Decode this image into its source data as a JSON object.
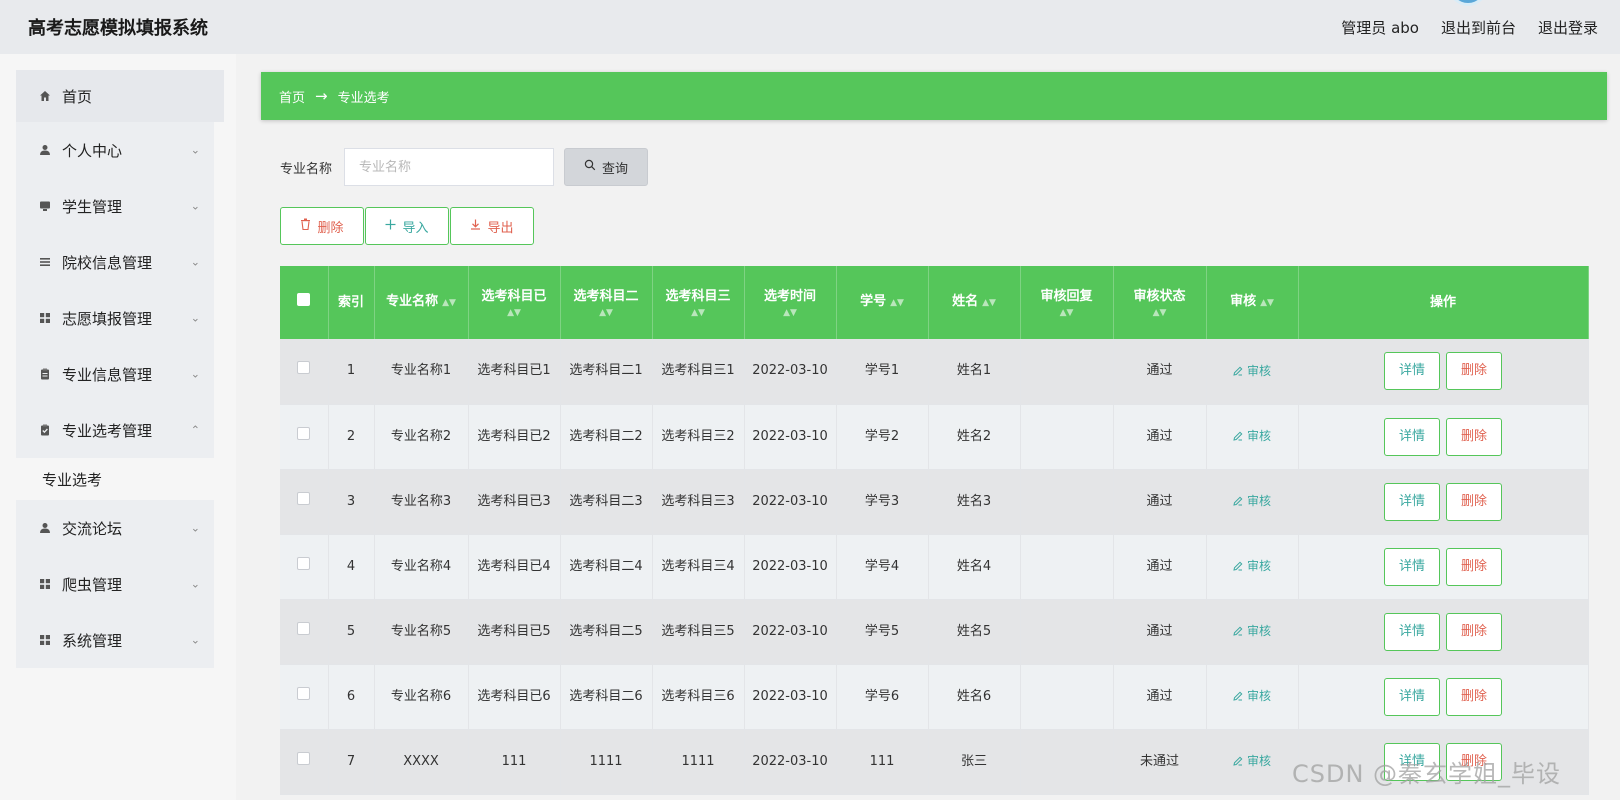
{
  "header": {
    "title": "高考志愿模拟填报系统",
    "user_label": "管理员 abo",
    "front_label": "退出到前台",
    "logout_label": "退出登录"
  },
  "sidebar": {
    "items": [
      {
        "label": "首页",
        "icon": "home-icon"
      },
      {
        "label": "个人中心",
        "icon": "user-icon"
      },
      {
        "label": "学生管理",
        "icon": "monitor-icon"
      },
      {
        "label": "院校信息管理",
        "icon": "list-icon"
      },
      {
        "label": "志愿填报管理",
        "icon": "grid-icon"
      },
      {
        "label": "专业信息管理",
        "icon": "clipboard-icon"
      },
      {
        "label": "专业选考管理",
        "icon": "clipboard-check-icon"
      },
      {
        "label": "交流论坛",
        "icon": "user-icon"
      },
      {
        "label": "爬虫管理",
        "icon": "grid-icon"
      },
      {
        "label": "系统管理",
        "icon": "grid-icon"
      }
    ],
    "submenu_label": "专业选考"
  },
  "breadcrumb": {
    "home": "首页",
    "current": "专业选考"
  },
  "search": {
    "label": "专业名称",
    "placeholder": "专业名称",
    "button": "查询"
  },
  "actions": {
    "delete": "删除",
    "import": "导入",
    "export": "导出"
  },
  "table": {
    "headers": [
      "索引",
      "专业名称",
      "选考科目已",
      "选考科目二",
      "选考科目三",
      "选考时间",
      "学号",
      "姓名",
      "审核回复",
      "审核状态",
      "审核",
      "操作"
    ],
    "audit_label": "审核",
    "detail_label": "详情",
    "remove_label": "删除",
    "rows": [
      {
        "index": "1",
        "name": "专业名称1",
        "s1": "选考科目已1",
        "s2": "选考科目二1",
        "s3": "选考科目三1",
        "time": "2022-03-10",
        "sid": "学号1",
        "sname": "姓名1",
        "reply": "",
        "status": "通过"
      },
      {
        "index": "2",
        "name": "专业名称2",
        "s1": "选考科目已2",
        "s2": "选考科目二2",
        "s3": "选考科目三2",
        "time": "2022-03-10",
        "sid": "学号2",
        "sname": "姓名2",
        "reply": "",
        "status": "通过"
      },
      {
        "index": "3",
        "name": "专业名称3",
        "s1": "选考科目已3",
        "s2": "选考科目二3",
        "s3": "选考科目三3",
        "time": "2022-03-10",
        "sid": "学号3",
        "sname": "姓名3",
        "reply": "",
        "status": "通过"
      },
      {
        "index": "4",
        "name": "专业名称4",
        "s1": "选考科目已4",
        "s2": "选考科目二4",
        "s3": "选考科目三4",
        "time": "2022-03-10",
        "sid": "学号4",
        "sname": "姓名4",
        "reply": "",
        "status": "通过"
      },
      {
        "index": "5",
        "name": "专业名称5",
        "s1": "选考科目已5",
        "s2": "选考科目二5",
        "s3": "选考科目三5",
        "time": "2022-03-10",
        "sid": "学号5",
        "sname": "姓名5",
        "reply": "",
        "status": "通过"
      },
      {
        "index": "6",
        "name": "专业名称6",
        "s1": "选考科目已6",
        "s2": "选考科目二6",
        "s3": "选考科目三6",
        "time": "2022-03-10",
        "sid": "学号6",
        "sname": "姓名6",
        "reply": "",
        "status": "通过"
      },
      {
        "index": "7",
        "name": "XXXX",
        "s1": "111",
        "s2": "1111",
        "s3": "1111",
        "time": "2022-03-10",
        "sid": "111",
        "sname": "张三",
        "reply": "",
        "status": "未通过"
      }
    ]
  },
  "watermark": "CSDN @秦玄学姐_毕设"
}
